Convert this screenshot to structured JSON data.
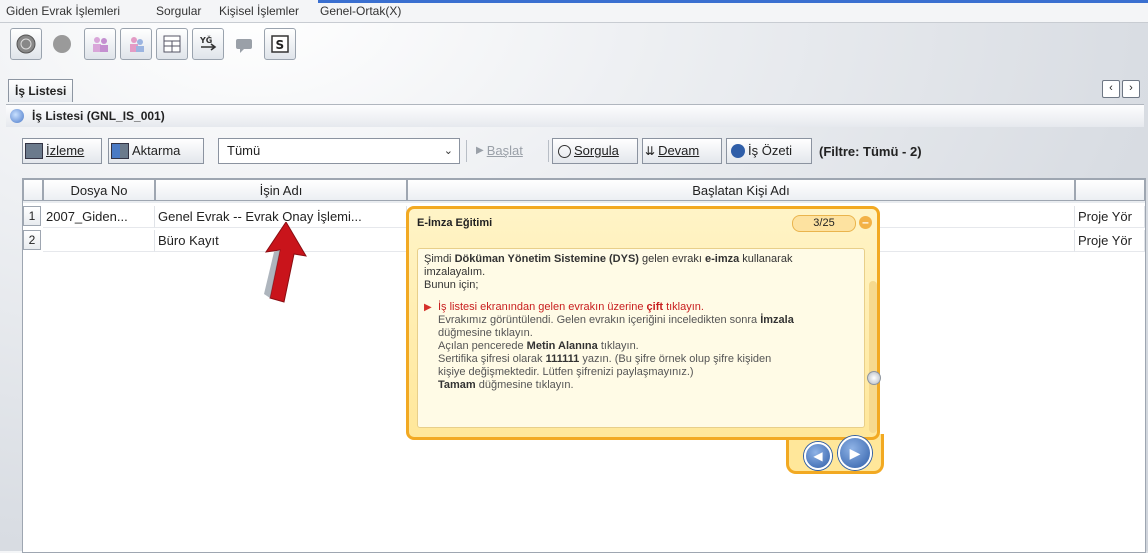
{
  "menu": [
    {
      "label": "Giden Evrak İşlemleri"
    },
    {
      "label": "Sorgular"
    },
    {
      "label": "Kişisel İşlemler"
    },
    {
      "label": "Genel-Ortak(X)"
    }
  ],
  "toolbar_icons": [
    "globe-icon",
    "stop-icon",
    "people-icon",
    "people-pink-icon",
    "table-icon",
    "transfer-icon",
    "comment-icon",
    "s-document-icon"
  ],
  "tab": {
    "label": "İş Listesi"
  },
  "panel": {
    "title": "İş Listesi (GNL_IS_001)"
  },
  "actions": {
    "izleme": "İzleme",
    "aktarma": "Aktarma",
    "filter_value": "Tümü",
    "baslat": "Başlat",
    "sorgula": "Sorgula",
    "devam": "Devam",
    "is_ozeti": "İş Özeti",
    "filter_label": "(Filtre: Tümü - 2)"
  },
  "grid": {
    "headers": [
      "Dosya No",
      "İşin Adı",
      "Başlatan Kişi Adı",
      ""
    ],
    "rows": [
      {
        "num": "1",
        "dosya_no": "2007_Giden...",
        "isin_adi": "Genel Evrak -- Evrak Onay İşlemi...",
        "baslatan": "Proje Yör"
      },
      {
        "num": "2",
        "dosya_no": "",
        "isin_adi": "Büro Kayıt",
        "baslatan": "Proje Yör"
      }
    ]
  },
  "popup": {
    "title": "E-İmza Eğitimi",
    "counter": "3/25",
    "intro_1_a": "Şimdi ",
    "intro_1_b": "Döküman Yönetim Sistemine (DYS)",
    "intro_1_c": " gelen evrakı ",
    "intro_1_d": "e-imza",
    "intro_1_e": " kullanarak",
    "intro_2": "imzalayalım.",
    "intro_3": "Bunun için;",
    "step_1_a": "İş listesi ekranından gelen evrakın üzerine ",
    "step_1_b": "çift",
    "step_1_c": " tıklayın.",
    "line_2": "Evrakımız görüntülendi. Gelen evrakın içeriğini inceledikten sonra ",
    "line_2_b": "İmzala",
    "line_3": "düğmesine tıklayın.",
    "line_4_a": "Açılan pencerede ",
    "line_4_b": "Metin Alanına",
    "line_4_c": " tıklayın.",
    "line_5_a": "Sertifika şifresi olarak ",
    "line_5_b": "111111",
    "line_5_c": " yazın. (Bu şifre örnek olup şifre kişiden",
    "line_6": "kişiye değişmektedir. Lütfen şifrenizi paylaşmayınız.)",
    "line_7_a": "Tamam",
    "line_7_b": " düğmesine tıklayın."
  }
}
